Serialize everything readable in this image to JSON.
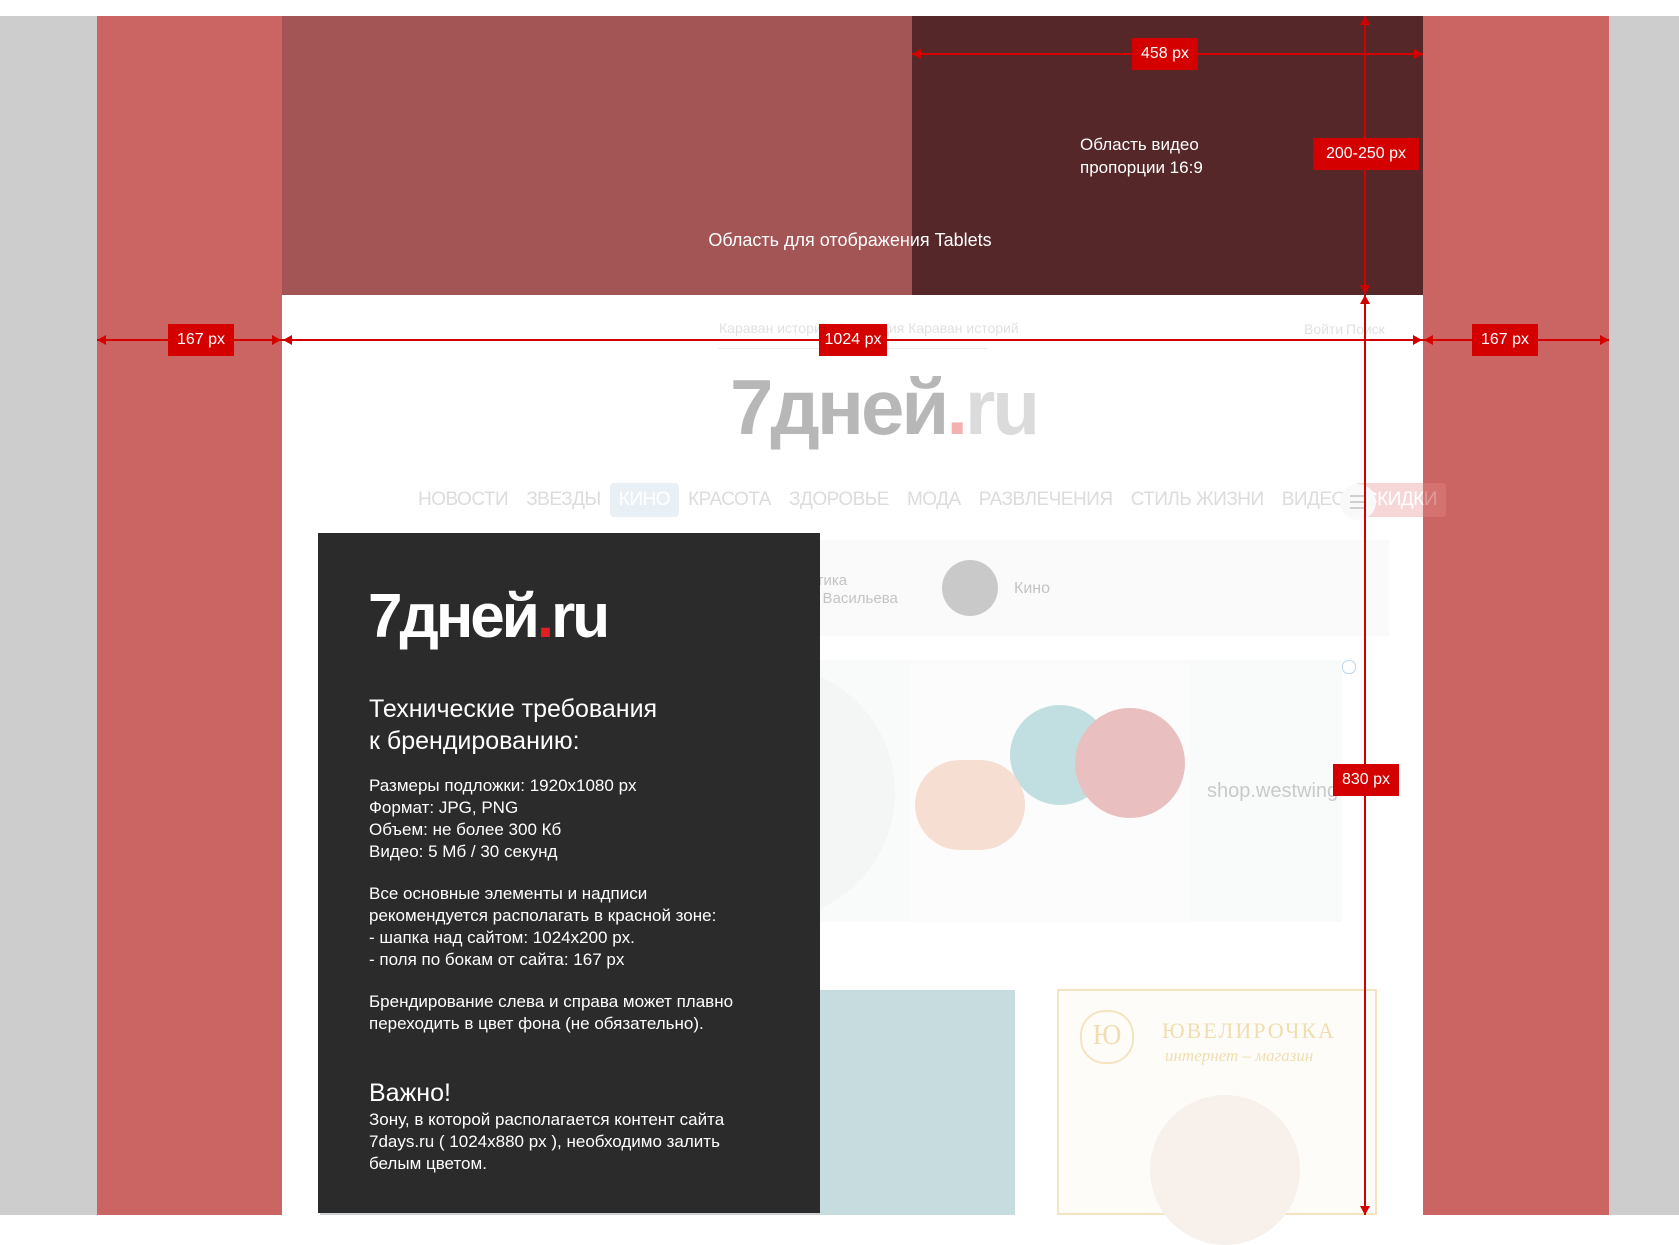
{
  "top_area": {
    "tablets_label": "Область для отображения Tablets",
    "video_label": "Область видео\nпропорции 16:9"
  },
  "dimensions": {
    "video_width": "458 px",
    "video_height": "200-250 px",
    "left_margin": "167 px",
    "right_margin": "167 px",
    "site_width": "1024 px",
    "site_height": "830 px"
  },
  "site": {
    "top_links": [
      "Караван историй",
      "Коллекция Караван историй"
    ],
    "login": "Войти",
    "search": "Поиск",
    "logo_main": "7дней",
    "logo_dot": ".",
    "logo_tld": "ru",
    "nav": [
      {
        "label": "НОВОСТИ",
        "state": "normal"
      },
      {
        "label": "ЗВЕЗДЫ",
        "state": "normal"
      },
      {
        "label": "КИНО",
        "state": "active"
      },
      {
        "label": "КРАСОТА",
        "state": "normal"
      },
      {
        "label": "ЗДОРОВЬЕ",
        "state": "normal"
      },
      {
        "label": "МОДА",
        "state": "normal"
      },
      {
        "label": "РАЗВЛЕЧЕНИЯ",
        "state": "normal"
      },
      {
        "label": "СТИЛЬ ЖИЗНИ",
        "state": "normal"
      },
      {
        "label": "ВИДЕО",
        "state": "normal"
      },
      {
        "label": "СКИДКИ",
        "state": "sale"
      }
    ],
    "rubric_1": "Модная критика\nАлександра Васильева",
    "rubric_2": "Кино",
    "ad_shop": "shop.westwing",
    "jewelry_brand": "ЮВЕЛИРОЧКА",
    "jewelry_sub": "интернет – магазин",
    "jewelry_logo": "Ю"
  },
  "panel": {
    "logo_main": "7дней",
    "logo_dot": ".",
    "logo_tld": "ru",
    "heading": "Технические требования\nк брендированию:",
    "specs": "Размеры подложки: 1920x1080 px\nФормат: JPG, PNG\nОбъем: не более 300 Кб\nВидео: 5 Мб / 30 секунд",
    "zone_text": "Все основные элементы и надписи\nрекомендуется располагать в красной зоне:\n- шапка над сайтом: 1024x200 px.\n- поля по бокам от сайта: 167 px",
    "branding_text": "Брендирование слева и справа может плавно\nпереходить в цвет фона (не обязательно).",
    "important_title": "Важно!",
    "important_text": "Зону, в которой располагается контент сайта\n7days.ru ( 1024x880 px ), необходимо залить\nбелым цветом."
  },
  "colors": {
    "side_red": "#cb6563",
    "tablets_area": "#a35455",
    "video_area": "#552729",
    "marker_red": "#d40000",
    "panel_bg": "#2b2b2b"
  }
}
